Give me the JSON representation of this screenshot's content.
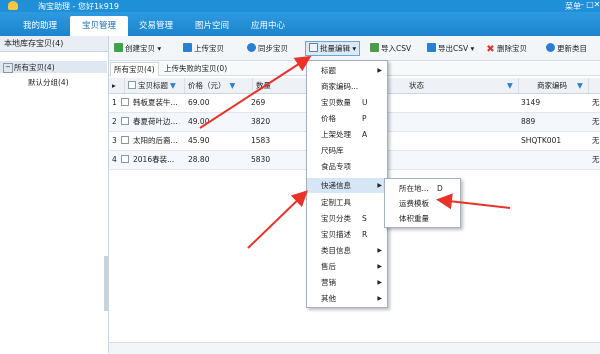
{
  "window": {
    "title": "淘宝助理 - 您好1k919",
    "menu_label": "菜单",
    "minimize": "–",
    "maximize": "□",
    "close": "✕"
  },
  "nav": {
    "tabs": [
      {
        "label": "我的助理"
      },
      {
        "label": "宝贝管理"
      },
      {
        "label": "交易管理"
      },
      {
        "label": "图片空间"
      },
      {
        "label": "应用中心"
      }
    ]
  },
  "left_panel": {
    "header": "本地库存宝贝(4)",
    "all_items": "所有宝贝(4)",
    "default_group": "默认分组(4)",
    "expander": "−"
  },
  "toolbar": {
    "create": "创建宝贝",
    "upload": "上传宝贝",
    "sync": "同步宝贝",
    "batch_edit": "批量编辑",
    "import_csv": "导入CSV",
    "export_csv": "导出CSV",
    "delete": "删除宝贝",
    "update_category": "更新类目"
  },
  "subtabs": {
    "all": "所有宝贝(4)",
    "upload_failed": "上传失败的宝贝(0)"
  },
  "table": {
    "headers": {
      "title": "宝贝标题",
      "price": "价格（元）",
      "quantity": "数量",
      "status": "状态",
      "merchant_code": "商家编码"
    },
    "rows": [
      {
        "num": "1",
        "title": "韩板夏装牛...",
        "price": "69.00",
        "qty": "269",
        "code": "3149",
        "extra": "无"
      },
      {
        "num": "2",
        "title": "春夏荷叶边...",
        "price": "49.00",
        "qty": "3820",
        "code": "889",
        "extra": "无"
      },
      {
        "num": "3",
        "title": "太阳的后裔...",
        "price": "45.90",
        "qty": "1583",
        "code": "SHQTK001",
        "extra": "无"
      },
      {
        "num": "4",
        "title": "2016春装...",
        "price": "28.80",
        "qty": "5830",
        "code": "",
        "extra": "无"
      }
    ]
  },
  "batch_menu": {
    "items": [
      {
        "label": "标题",
        "shortcut": "",
        "submenu": true
      },
      {
        "label": "商家编码...",
        "shortcut": "",
        "submenu": false
      },
      {
        "label": "宝贝数量",
        "shortcut": "U",
        "submenu": false
      },
      {
        "label": "价格",
        "shortcut": "P",
        "submenu": false
      },
      {
        "label": "上架处理",
        "shortcut": "A",
        "submenu": false
      },
      {
        "label": "尺码库",
        "shortcut": "",
        "submenu": false
      },
      {
        "label": "食品专项",
        "shortcut": "",
        "submenu": false
      },
      {
        "label": "快递信息",
        "shortcut": "",
        "submenu": true
      },
      {
        "label": "定制工具",
        "shortcut": "",
        "submenu": false
      },
      {
        "label": "宝贝分类",
        "shortcut": "S",
        "submenu": false
      },
      {
        "label": "宝贝描述",
        "shortcut": "R",
        "submenu": false
      },
      {
        "label": "类目信息",
        "shortcut": "",
        "submenu": true
      },
      {
        "label": "售后",
        "shortcut": "",
        "submenu": true
      },
      {
        "label": "营销",
        "shortcut": "",
        "submenu": true
      },
      {
        "label": "其他",
        "shortcut": "",
        "submenu": true
      }
    ]
  },
  "express_submenu": {
    "items": [
      {
        "label": "所在地...",
        "shortcut": "D"
      },
      {
        "label": "运费模板",
        "shortcut": ""
      },
      {
        "label": "体积重量",
        "shortcut": ""
      }
    ]
  },
  "colors": {
    "brand_blue": "#1f8fd8",
    "annotation_red": "#e8322a",
    "menu_highlight": "#d7e6f4"
  }
}
